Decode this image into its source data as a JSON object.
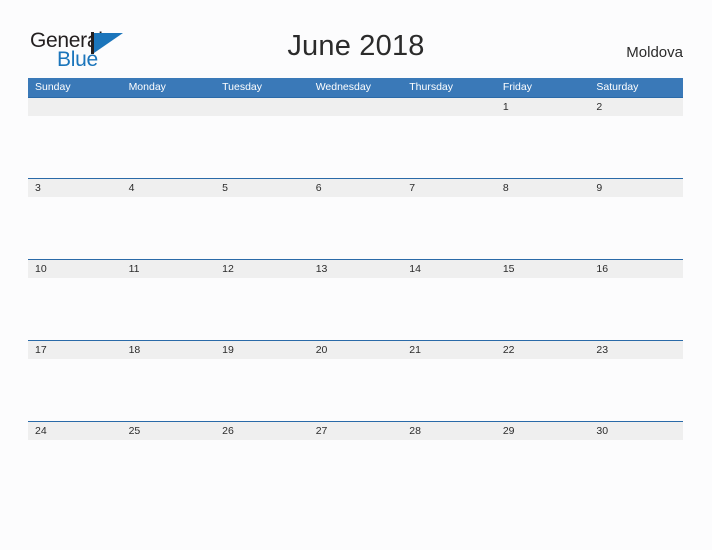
{
  "brand": {
    "name_part1": "General",
    "name_part2": "Blue",
    "flag_icon": "blue-flag-triangle",
    "colors": {
      "black": "#231f20",
      "blue": "#1b75bb"
    }
  },
  "header": {
    "title": "June 2018",
    "region": "Moldova"
  },
  "calendar": {
    "colors": {
      "header_blue": "#3a79b8",
      "row_line_blue": "#2a6aa8",
      "date_band_gray": "#efefef",
      "page_background": "#fcfcfd",
      "text": "#2b2b2b"
    },
    "day_headers": [
      "Sunday",
      "Monday",
      "Tuesday",
      "Wednesday",
      "Thursday",
      "Friday",
      "Saturday"
    ],
    "weeks": [
      [
        "",
        "",
        "",
        "",
        "",
        "1",
        "2"
      ],
      [
        "3",
        "4",
        "5",
        "6",
        "7",
        "8",
        "9"
      ],
      [
        "10",
        "11",
        "12",
        "13",
        "14",
        "15",
        "16"
      ],
      [
        "17",
        "18",
        "19",
        "20",
        "21",
        "22",
        "23"
      ],
      [
        "24",
        "25",
        "26",
        "27",
        "28",
        "29",
        "30"
      ]
    ]
  }
}
